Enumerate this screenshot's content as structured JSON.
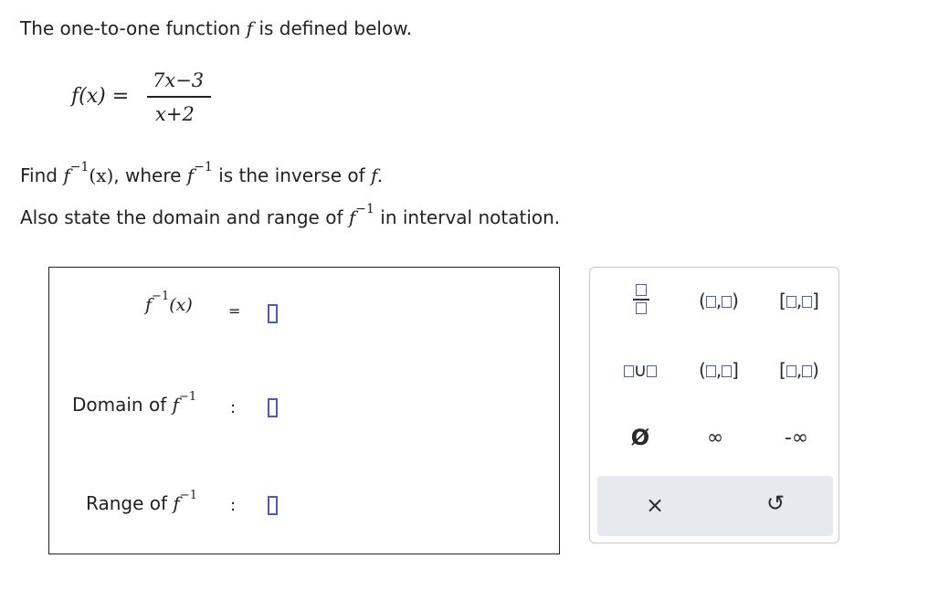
{
  "intro": {
    "line1": "The one-to-one function",
    "f": "f",
    "line1_end": "is defined below."
  },
  "definition": {
    "lhs": "f(x) =",
    "numerator": "7x−3",
    "denominator": "x+2"
  },
  "task": {
    "find": "Find",
    "f": "f",
    "minus_one": "−1",
    "x_paren": "(x)",
    "where": ", where",
    "inverse_of": "is the inverse of",
    "period_f": "f.",
    "also": "Also state the domain and range of",
    "interval": "in interval notation."
  },
  "answer": {
    "finv_label": "f",
    "finv_sup": "−1",
    "finv_arg": "(x)",
    "equals": "=",
    "domain_label": "Domain of",
    "range_label": "Range of",
    "f": "f",
    "sup": "−1",
    "colon": ":"
  },
  "keypad": {
    "union_symbol": "∪",
    "empty_set": "Ø",
    "infinity": "∞",
    "neg_infinity": "-∞",
    "clear": "×",
    "undo": "↺",
    "paren_open": "(",
    "paren_close": ")",
    "bracket_open": "[",
    "bracket_close": "]",
    "comma": ","
  },
  "colors": {
    "slot_border": "#4a5bd0",
    "keypad_bottom_bg": "#e6e9ed"
  }
}
